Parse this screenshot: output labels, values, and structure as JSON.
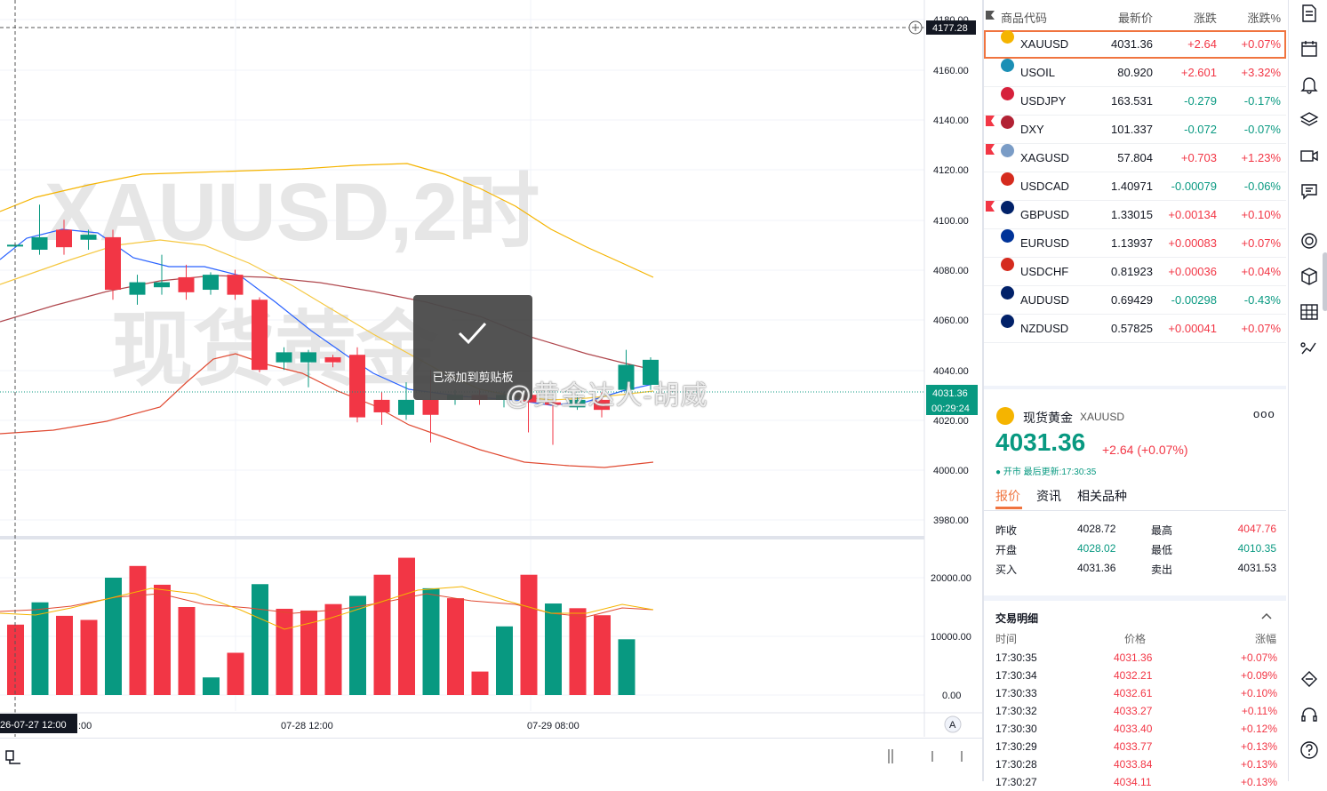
{
  "chart": {
    "watermark_symbol": "XAUUSD,2时",
    "watermark_name": "现货黄金",
    "crosshair_price": "4177.28",
    "last_price_tag": "4031.36",
    "countdown_tag": "00:29:24",
    "price_axis": [
      "4180.00",
      "4160.00",
      "4140.00",
      "4120.00",
      "4100.00",
      "4080.00",
      "4060.00",
      "4040.00",
      "4020.00",
      "4000.00",
      "3980.00"
    ],
    "volume_axis": [
      "20000.00",
      "10000.00",
      "0.00"
    ],
    "time_axis": [
      ":00",
      "07-28 12:00",
      "07-29 08:00"
    ],
    "crosshair_time": "26-07-27  12:00",
    "auto_scale_label": "A",
    "toast_message": "已添加到剪贴板",
    "weibo_watermark": "@黄金达人-胡威"
  },
  "chart_data": {
    "type": "candlestick",
    "candles": [
      {
        "o": 4090,
        "c": 4090,
        "h": 4091,
        "l": 4089
      },
      {
        "o": 4088,
        "c": 4093,
        "h": 4106,
        "l": 4086
      },
      {
        "o": 4096,
        "c": 4089,
        "h": 4100,
        "l": 4086
      },
      {
        "o": 4092,
        "c": 4094,
        "h": 4096,
        "l": 4088
      },
      {
        "o": 4093,
        "c": 4072,
        "h": 4096,
        "l": 4068
      },
      {
        "o": 4070,
        "c": 4075,
        "h": 4078,
        "l": 4066
      },
      {
        "o": 4073,
        "c": 4075,
        "h": 4086,
        "l": 4070
      },
      {
        "o": 4077,
        "c": 4071,
        "h": 4082,
        "l": 4068
      },
      {
        "o": 4072,
        "c": 4078,
        "h": 4079,
        "l": 4070
      },
      {
        "o": 4078,
        "c": 4070,
        "h": 4080,
        "l": 4068
      },
      {
        "o": 4068,
        "c": 4040,
        "h": 4069,
        "l": 4039
      },
      {
        "o": 4043,
        "c": 4047,
        "h": 4049,
        "l": 4040
      },
      {
        "o": 4043,
        "c": 4047,
        "h": 4048,
        "l": 4033
      },
      {
        "o": 4045,
        "c": 4043,
        "h": 4046,
        "l": 4041
      },
      {
        "o": 4046,
        "c": 4021,
        "h": 4049,
        "l": 4019
      },
      {
        "o": 4028,
        "c": 4023,
        "h": 4031,
        "l": 4018
      },
      {
        "o": 4022,
        "c": 4028,
        "h": 4035,
        "l": 4020
      },
      {
        "o": 4028,
        "c": 4022,
        "h": 4040,
        "l": 4011
      },
      {
        "o": 4028,
        "c": 4030,
        "h": 4032,
        "l": 4026
      },
      {
        "o": 4030,
        "c": 4028,
        "h": 4032,
        "l": 4026
      },
      {
        "o": 4028,
        "c": 4030,
        "h": 4031,
        "l": 4025
      },
      {
        "o": 4030,
        "c": 4027,
        "h": 4031,
        "l": 4015
      },
      {
        "o": 4027,
        "c": 4026,
        "h": 4028,
        "l": 4010
      },
      {
        "o": 4025,
        "c": 4028,
        "h": 4030,
        "l": 4024
      },
      {
        "o": 4028,
        "c": 4024,
        "h": 4031,
        "l": 4021
      },
      {
        "o": 4032,
        "c": 4042,
        "h": 4048,
        "l": 4030
      },
      {
        "o": 4034,
        "c": 4044,
        "h": 4045,
        "l": 4032
      }
    ],
    "volume": [
      12000,
      15800,
      13500,
      12800,
      20000,
      22000,
      18800,
      15000,
      3000,
      7200,
      18900,
      14700,
      14400,
      15500,
      16900,
      20500,
      23400,
      18200,
      16500,
      4000,
      11700,
      20500,
      15600,
      14800,
      13600,
      9500
    ],
    "ylim": [
      3975,
      4185
    ]
  },
  "watchlist": {
    "headers": {
      "symbol": "商品代码",
      "last": "最新价",
      "change": "涨跌",
      "change_pct": "涨跌%"
    },
    "rows": [
      {
        "symbol": "XAUUSD",
        "last": "4031.36",
        "change": "+2.64",
        "pct": "+0.07%",
        "dir": "up",
        "icon": "#f5b400",
        "bookmark": false
      },
      {
        "symbol": "USOIL",
        "last": "80.920",
        "change": "+2.601",
        "pct": "+3.32%",
        "dir": "up",
        "icon": "#1b8fb5",
        "bookmark": false
      },
      {
        "symbol": "USDJPY",
        "last": "163.531",
        "change": "-0.279",
        "pct": "-0.17%",
        "dir": "down",
        "icon": "#d6213b",
        "bookmark": false
      },
      {
        "symbol": "DXY",
        "last": "101.337",
        "change": "-0.072",
        "pct": "-0.07%",
        "dir": "down",
        "icon": "#b22234",
        "bookmark": true
      },
      {
        "symbol": "XAGUSD",
        "last": "57.804",
        "change": "+0.703",
        "pct": "+1.23%",
        "dir": "up",
        "icon": "#7a9cc6",
        "bookmark": true
      },
      {
        "symbol": "USDCAD",
        "last": "1.40971",
        "change": "-0.00079",
        "pct": "-0.06%",
        "dir": "down",
        "icon": "#d52b1e",
        "bookmark": false
      },
      {
        "symbol": "GBPUSD",
        "last": "1.33015",
        "change": "+0.00134",
        "pct": "+0.10%",
        "dir": "up",
        "icon": "#012169",
        "bookmark": true
      },
      {
        "symbol": "EURUSD",
        "last": "1.13937",
        "change": "+0.00083",
        "pct": "+0.07%",
        "dir": "up",
        "icon": "#003399",
        "bookmark": false
      },
      {
        "symbol": "USDCHF",
        "last": "0.81923",
        "change": "+0.00036",
        "pct": "+0.04%",
        "dir": "up",
        "icon": "#d52b1e",
        "bookmark": false
      },
      {
        "symbol": "AUDUSD",
        "last": "0.69429",
        "change": "-0.00298",
        "pct": "-0.43%",
        "dir": "down",
        "icon": "#012169",
        "bookmark": false
      },
      {
        "symbol": "NZDUSD",
        "last": "0.57825",
        "change": "+0.00041",
        "pct": "+0.07%",
        "dir": "up",
        "icon": "#012169",
        "bookmark": false
      }
    ]
  },
  "detail": {
    "name": "现货黄金",
    "symbol": "XAUUSD",
    "more": "ooo",
    "price": "4031.36",
    "change": "+2.64 (+0.07%)",
    "status": "● 开市  最后更新:17:30:35",
    "tabs": [
      "报价",
      "资讯",
      "相关品种"
    ],
    "stats": [
      {
        "l1": "昨收",
        "v1": "4028.72",
        "c1": "#131722",
        "l2": "最高",
        "v2": "4047.76",
        "c2": "#f23645"
      },
      {
        "l1": "开盘",
        "v1": "4028.02",
        "c1": "#089981",
        "l2": "最低",
        "v2": "4010.35",
        "c2": "#089981"
      },
      {
        "l1": "买入",
        "v1": "4031.36",
        "c1": "#131722",
        "l2": "卖出",
        "v2": "4031.53",
        "c2": "#131722"
      }
    ],
    "ticks_title": "交易明细",
    "ticks_headers": [
      "时间",
      "价格",
      "涨幅"
    ],
    "ticks": [
      [
        "17:30:35",
        "4031.36",
        "+0.07%"
      ],
      [
        "17:30:34",
        "4032.21",
        "+0.09%"
      ],
      [
        "17:30:33",
        "4032.61",
        "+0.10%"
      ],
      [
        "17:30:32",
        "4033.27",
        "+0.11%"
      ],
      [
        "17:30:30",
        "4033.40",
        "+0.12%"
      ],
      [
        "17:30:29",
        "4033.77",
        "+0.13%"
      ],
      [
        "17:30:28",
        "4033.84",
        "+0.13%"
      ],
      [
        "17:30:27",
        "4034.11",
        "+0.13%"
      ]
    ]
  },
  "colors": {
    "up": "#f23645",
    "down": "#089981",
    "accent": "#f0743f"
  }
}
